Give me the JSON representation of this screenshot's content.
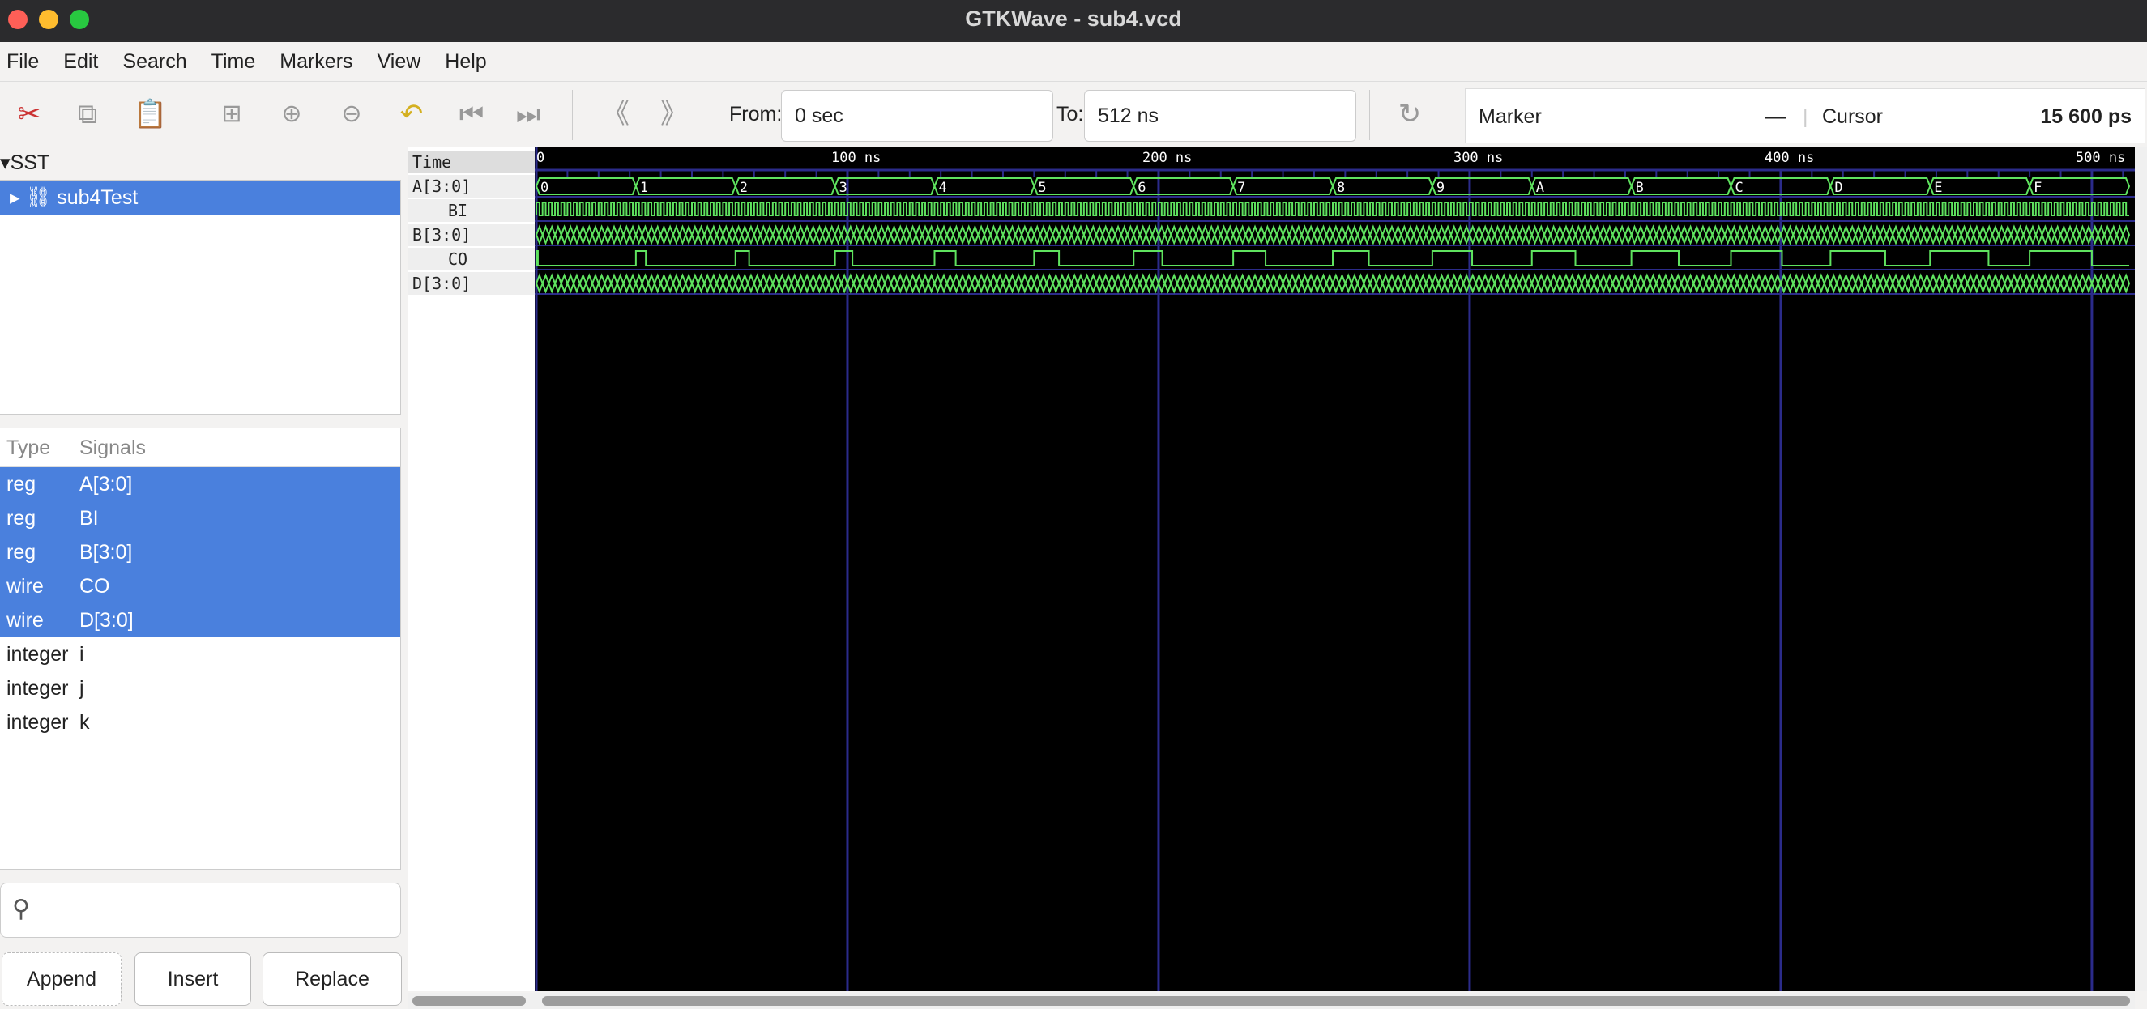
{
  "window": {
    "title": "GTKWave - sub4.vcd"
  },
  "menu": [
    "File",
    "Edit",
    "Search",
    "Time",
    "Markers",
    "View",
    "Help"
  ],
  "toolbar": {
    "from_label": "From:",
    "from_value": "0 sec",
    "to_label": "To:",
    "to_value": "512 ns",
    "marker_label": "Marker",
    "marker_value": "—",
    "cursor_label": "Cursor",
    "cursor_value": "15 600 ps",
    "icons": [
      "cut-icon",
      "copy-icon",
      "paste-icon",
      "zoom-fit-icon",
      "zoom-in-icon",
      "zoom-out-icon",
      "undo-zoom-icon",
      "zoom-start-icon",
      "zoom-end-icon",
      "prev-edge-icon",
      "next-edge-icon",
      "reload-icon"
    ]
  },
  "tree": {
    "header": "SST",
    "module": "sub4Test"
  },
  "signals_table": {
    "headers": [
      "Type",
      "Signals"
    ],
    "rows": [
      {
        "type": "reg",
        "name": "A[3:0]",
        "selected": true
      },
      {
        "type": "reg",
        "name": "BI",
        "selected": true
      },
      {
        "type": "reg",
        "name": "B[3:0]",
        "selected": true
      },
      {
        "type": "wire",
        "name": "CO",
        "selected": true
      },
      {
        "type": "wire",
        "name": "D[3:0]",
        "selected": true
      },
      {
        "type": "integer",
        "name": "i",
        "selected": false
      },
      {
        "type": "integer",
        "name": "j",
        "selected": false
      },
      {
        "type": "integer",
        "name": "k",
        "selected": false
      }
    ]
  },
  "buttons": {
    "append": "Append",
    "insert": "Insert",
    "replace": "Replace"
  },
  "waves": {
    "time_header": "Time",
    "names": [
      "A[3:0]",
      "BI",
      "B[3:0]",
      "CO",
      "D[3:0]"
    ],
    "tick_labels": [
      "0",
      "100 ns",
      "200 ns",
      "300 ns",
      "400 ns",
      "500 ns"
    ],
    "range_ns": [
      0,
      512
    ],
    "A_values": [
      "0",
      "1",
      "2",
      "3",
      "4",
      "5",
      "6",
      "7",
      "8",
      "9",
      "A",
      "B",
      "C",
      "D",
      "E",
      "F"
    ],
    "colors": {
      "wave": "#5fe35f",
      "grid": "#2b2b8a"
    }
  }
}
